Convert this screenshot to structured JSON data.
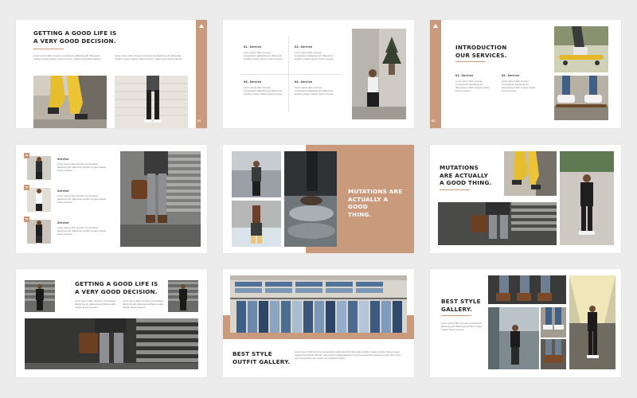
{
  "colors": {
    "accent": "#c99a7c",
    "background": "#ececec",
    "slide": "#ffffff",
    "title": "#222222"
  },
  "lorem_a": "Lorem ipsum dolor sit amet, consectetuer adipiscing elit. Maecenas porttitor congue massa. Fusce posuere, magna sed pulvinar ultricies.",
  "lorem_b": "Lorem ipsum dolor sit amet, consectetuer adipiscing elit. Maecenas porttitor congue massa. Fusce posuere.",
  "lorem_long": "Lorem ipsum dolor sit amet, consectetuer adipiscing elit. Maecenas porttitor congue massa. Fusce posuere, magna sed pulvinar ultricies, purus lectus malesuada libero, sit amet commodo magna eros quis urna. Nunc viverra imperdiet enim. Fusce est. Vivamus a tellus.",
  "slide1": {
    "title": "Getting a good life is\na very good decision.",
    "page": "01"
  },
  "slide2": {
    "s1": "01. Service",
    "s2": "02. Service",
    "s3": "03. Service",
    "s4": "04. Service"
  },
  "slide3": {
    "title": "Introduction\nour services.",
    "s1": "01. Service",
    "s2": "02. Service",
    "page": "02"
  },
  "slide4": {
    "n1": "01",
    "n2": "02",
    "n3": "03",
    "label": "Service"
  },
  "slide5": {
    "title": "Mutations are\nactually a good\nthing."
  },
  "slide6": {
    "title": "Mutations\nare actually\na good thing."
  },
  "slide7": {
    "title": "Getting a good life is\na very good decision."
  },
  "slide8": {
    "title": "Best style\noutfit gallery."
  },
  "slide9": {
    "title": "Best style\ngallery."
  }
}
